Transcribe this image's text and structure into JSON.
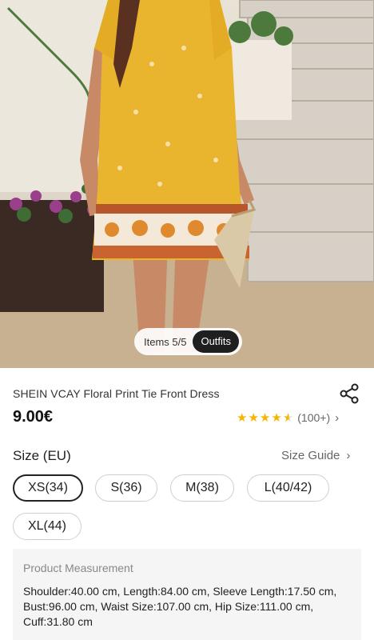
{
  "image": {
    "items_label": "Items 5/5",
    "outfits_label": "Outfits"
  },
  "product": {
    "title": "SHEIN VCAY Floral Print Tie Front Dress",
    "price": "9.00€",
    "rating_stars": 4.5,
    "review_count": "(100+)"
  },
  "size": {
    "label": "Size (EU)",
    "guide_label": "Size Guide",
    "options": [
      "XS(34)",
      "S(36)",
      "M(38)",
      "L(40/42)",
      "XL(44)"
    ],
    "selected": "XS(34)"
  },
  "measurement": {
    "title": "Product Measurement",
    "body": "Shoulder:40.00 cm, Length:84.00 cm, Sleeve Length:17.50 cm, Bust:96.00 cm, Waist Size:107.00 cm, Hip Size:111.00 cm, Cuff:31.80 cm"
  },
  "colors": {
    "star": "#f7b500",
    "pill_dark": "#1f1f1f",
    "dress_yellow": "#e9b52f"
  },
  "icons": {
    "share": "share-icon",
    "chevron": "chevron-right-icon",
    "star": "star-icon"
  }
}
